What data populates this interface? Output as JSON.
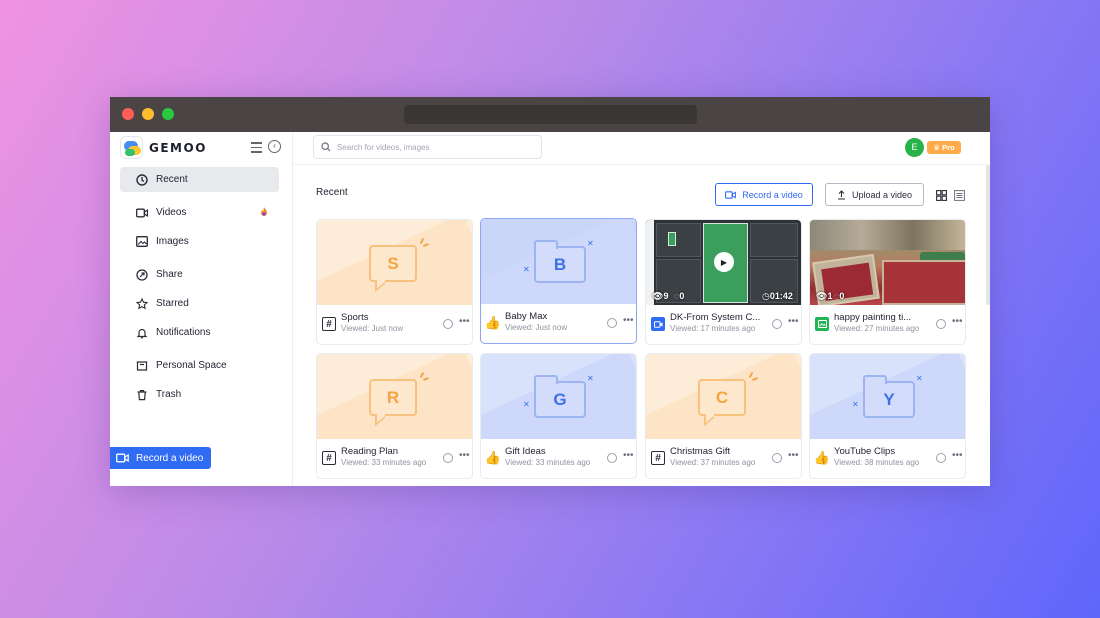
{
  "brand": {
    "name": "GEMOO"
  },
  "search": {
    "placeholder": "Search for videos, images"
  },
  "user": {
    "avatar_initial": "E",
    "plan_badge": "Pro"
  },
  "sidebar": {
    "items": [
      {
        "label": "Recent",
        "icon": "clock-icon",
        "active": true
      },
      {
        "label": "Videos",
        "icon": "video-icon"
      },
      {
        "label": "Images",
        "icon": "image-icon"
      },
      {
        "label": "Share",
        "icon": "share-icon"
      },
      {
        "label": "Starred",
        "icon": "star-icon"
      },
      {
        "label": "Notifications",
        "icon": "bell-icon"
      },
      {
        "label": "Personal Space",
        "icon": "folder-icon"
      },
      {
        "label": "Trash",
        "icon": "trash-icon"
      }
    ],
    "record_label": "Record a video"
  },
  "main": {
    "title": "Recent",
    "record_button": "Record a video",
    "upload_button": "Upload a video"
  },
  "cards": [
    {
      "title": "Sports",
      "meta": "Viewed: Just now",
      "type": "hash",
      "thumb": "orange",
      "letter": "S"
    },
    {
      "title": "Baby Max",
      "meta": "Viewed: Just now",
      "type": "like",
      "thumb": "blue",
      "letter": "B"
    },
    {
      "title": "DK-From System C...",
      "meta": "Viewed: 17 minutes ago",
      "type": "video",
      "thumb": "video",
      "views": "9",
      "comments": "0",
      "duration": "01:42"
    },
    {
      "title": "happy painting ti...",
      "meta": "Viewed: 27 minutes ago",
      "type": "image",
      "thumb": "photo",
      "views": "1",
      "comments": "0"
    },
    {
      "title": "Reading Plan",
      "meta": "Viewed: 33 minutes ago",
      "type": "hash",
      "thumb": "orange",
      "letter": "R"
    },
    {
      "title": "Gift Ideas",
      "meta": "Viewed: 33 minutes ago",
      "type": "like",
      "thumb": "blue",
      "letter": "G"
    },
    {
      "title": "Christmas Gift",
      "meta": "Viewed: 37 minutes ago",
      "type": "hash",
      "thumb": "orange",
      "letter": "C"
    },
    {
      "title": "YouTube Clips",
      "meta": "Viewed: 38 minutes ago",
      "type": "like",
      "thumb": "blue",
      "letter": "Y"
    }
  ]
}
